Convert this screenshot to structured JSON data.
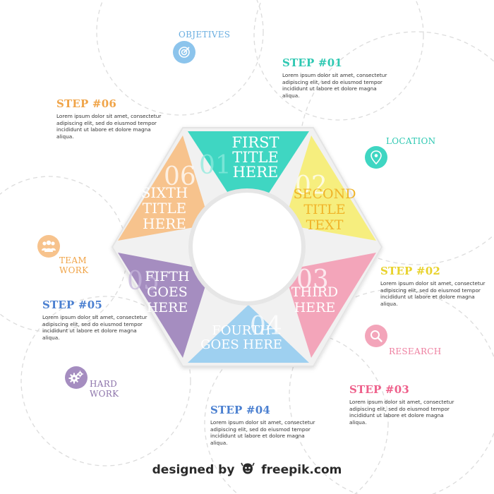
{
  "colors": {
    "teal": "#3fd6c2",
    "yellow": "#f6ee7e",
    "pink": "#f3a5ba",
    "blue": "#9ed0f0",
    "purple": "#a58dc0",
    "orange": "#f7c38d",
    "heading_pink": "#ee5f8a",
    "heading_yellow": "#e8d22c",
    "heading_orange": "#f0a448",
    "heading_blue": "#4a7fd0",
    "heading_teal": "#2ec8b2"
  },
  "segments": [
    {
      "number": "01",
      "lines": [
        "FIRST",
        "TITLE",
        "HERE"
      ],
      "color": "#3fd6c2"
    },
    {
      "number": "02",
      "lines": [
        "SECOND",
        "TITLE",
        "TEXT"
      ],
      "color": "#f6ee7e"
    },
    {
      "number": "03",
      "lines": [
        "THIRD",
        "HERE"
      ],
      "color": "#f3a5ba"
    },
    {
      "number": "04",
      "lines": [
        "FOURTH",
        "GOES HERE"
      ],
      "color": "#9ed0f0"
    },
    {
      "number": "05",
      "lines": [
        "FIFTH",
        "GOES",
        "HERE"
      ],
      "color": "#a58dc0"
    },
    {
      "number": "06",
      "lines": [
        "SIXTH",
        "TITLE",
        "HERE"
      ],
      "color": "#f7c38d"
    }
  ],
  "steps": {
    "step1": {
      "title": "STEP #01",
      "body": "Lorem ipsum dolor sit amet, consectetur adipiscing elit, sed do eiusmod tempor incididunt ut labore et dolore magna aliqua."
    },
    "step2": {
      "title": "STEP #02",
      "body": "Lorem ipsum dolor sit amet, consectetur adipiscing elit, sed do eiusmod tempor incididunt ut labore et dolore magna aliqua."
    },
    "step3": {
      "title": "STEP #03",
      "body": "Lorem ipsum dolor sit amet, consectetur adipiscing elit, sed do eiusmod tempor incididunt ut labore et dolore magna aliqua."
    },
    "step4": {
      "title": "STEP #04",
      "body": "Lorem ipsum dolor sit amet, consectetur adipiscing elit, sed do eiusmod tempor incididunt ut labore et dolore magna aliqua."
    },
    "step5": {
      "title": "STEP #05",
      "body": "Lorem ipsum dolor sit amet, consectetur adipiscing elit, sed do eiusmod tempor incididunt ut labore et dolore magna aliqua."
    },
    "step6": {
      "title": "STEP #06",
      "body": "Lorem ipsum dolor sit amet, consectetur adipiscing elit, sed do eiusmod tempor incididunt ut labore et dolore magna aliqua."
    }
  },
  "icons": {
    "objectives": {
      "label": "OBJETIVES",
      "icon": "target-icon",
      "color": "#8cc4ec"
    },
    "location": {
      "label": "LOCATION",
      "icon": "map-pin-icon",
      "color": "#3fd6c2"
    },
    "research": {
      "label": "RESEARCH",
      "icon": "search-icon",
      "color": "#f3a5ba"
    },
    "team_work": {
      "label_line1": "TEAM",
      "label_line2": "WORK",
      "icon": "team-icon",
      "color": "#f7c38d"
    },
    "hard_work": {
      "label_line1": "HARD",
      "label_line2": "WORK",
      "icon": "gears-icon",
      "color": "#a58dc0"
    }
  },
  "footer": {
    "prefix": "designed by",
    "brand": "freepik.com"
  }
}
